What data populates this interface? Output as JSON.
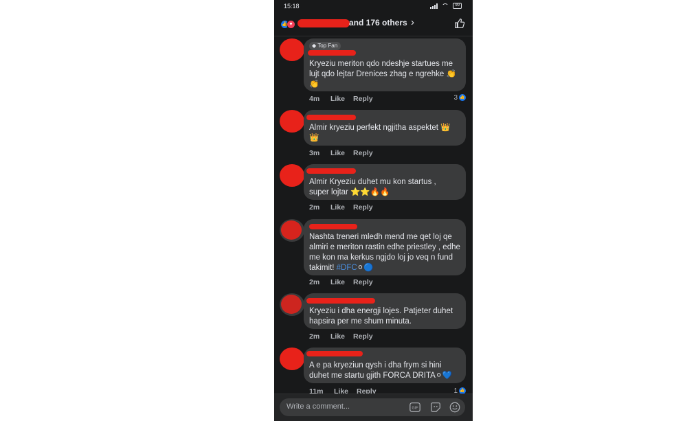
{
  "status_bar": {
    "time": "15:18",
    "battery": "99"
  },
  "header": {
    "reaction_text": "and 176 others"
  },
  "comments": [
    {
      "badge": "Top Fan",
      "text": "Kryeziu meriton qdo ndeshje startues me lujt qdo lejtar Drenices zhag e ngrehke 👏",
      "text2": "👏",
      "time": "4m",
      "like": "Like",
      "reply": "Reply",
      "reactions": "3"
    },
    {
      "text": "Almir kryeziu perfekt ngjitha aspektet 👑",
      "text2": "👑",
      "time": "3m",
      "like": "Like",
      "reply": "Reply"
    },
    {
      "text": "Almir Kryeziu duhet mu kon startus ,",
      "text2": "super lojtar ⭐⭐🔥🔥",
      "time": "2m",
      "like": "Like",
      "reply": "Reply"
    },
    {
      "text": "Nashta treneri mledh mend me qet loj qe almiri e meriton rastin edhe priestley , edhe me kon ma kerkus ngjdo loj jo veq n fund takimit!",
      "hashtag": "#DFC",
      "emoji": "⚪🔵",
      "time": "2m",
      "like": "Like",
      "reply": "Reply"
    },
    {
      "text": "Kryeziu i dha energji lojes. Patjeter duhet hapsira per me shum minuta.",
      "time": "2m",
      "like": "Like",
      "reply": "Reply"
    },
    {
      "text": "A e pa kryeziun qysh i dha frym si hini duhet me startu gjith FORCA DRITA⚪💙",
      "time": "11m",
      "like": "Like",
      "reply": "Reply",
      "reactions": "1"
    }
  ],
  "input": {
    "placeholder": "Write a comment..."
  },
  "icons": [
    "signal-icon",
    "wifi-icon",
    "battery-icon",
    "like-reaction-icon",
    "love-reaction-icon",
    "chevron-right-icon",
    "thumbs-up-icon",
    "gif-icon",
    "sticker-icon",
    "emoji-icon"
  ]
}
